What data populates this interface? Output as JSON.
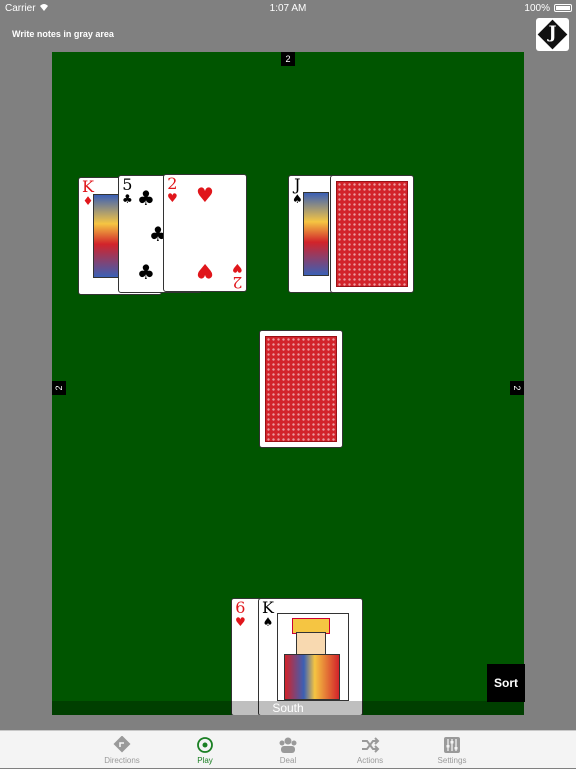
{
  "status_bar": {
    "carrier": "Carrier",
    "time": "1:07 AM",
    "battery": "100%"
  },
  "header": {
    "notes_hint": "Write notes in gray area",
    "logo_letter": "J"
  },
  "table": {
    "counts": {
      "north": "2",
      "west": "2",
      "east": "2"
    },
    "south_label": "South",
    "sort_label": "Sort",
    "west_hand": [
      {
        "rank": "K",
        "suit": "♦",
        "color": "red"
      },
      {
        "rank": "5",
        "suit": "♣",
        "color": "black"
      },
      {
        "rank": "2",
        "suit": "♥",
        "color": "red"
      }
    ],
    "east_hand": [
      {
        "rank": "J",
        "suit": "♠",
        "color": "black"
      }
    ],
    "south_hand": [
      {
        "rank": "6",
        "suit": "♥",
        "color": "red"
      },
      {
        "rank": "K",
        "suit": "♠",
        "color": "black"
      }
    ]
  },
  "tabs": [
    {
      "label": "Directions",
      "icon": "directions-icon",
      "active": false
    },
    {
      "label": "Play",
      "icon": "play-icon",
      "active": true
    },
    {
      "label": "Deal",
      "icon": "deal-icon",
      "active": false
    },
    {
      "label": "Actions",
      "icon": "shuffle-icon",
      "active": false
    },
    {
      "label": "Settings",
      "icon": "sliders-icon",
      "active": false
    }
  ],
  "colors": {
    "felt": "#005500",
    "accent": "#1a7f23",
    "card_back": "#d2232a"
  }
}
